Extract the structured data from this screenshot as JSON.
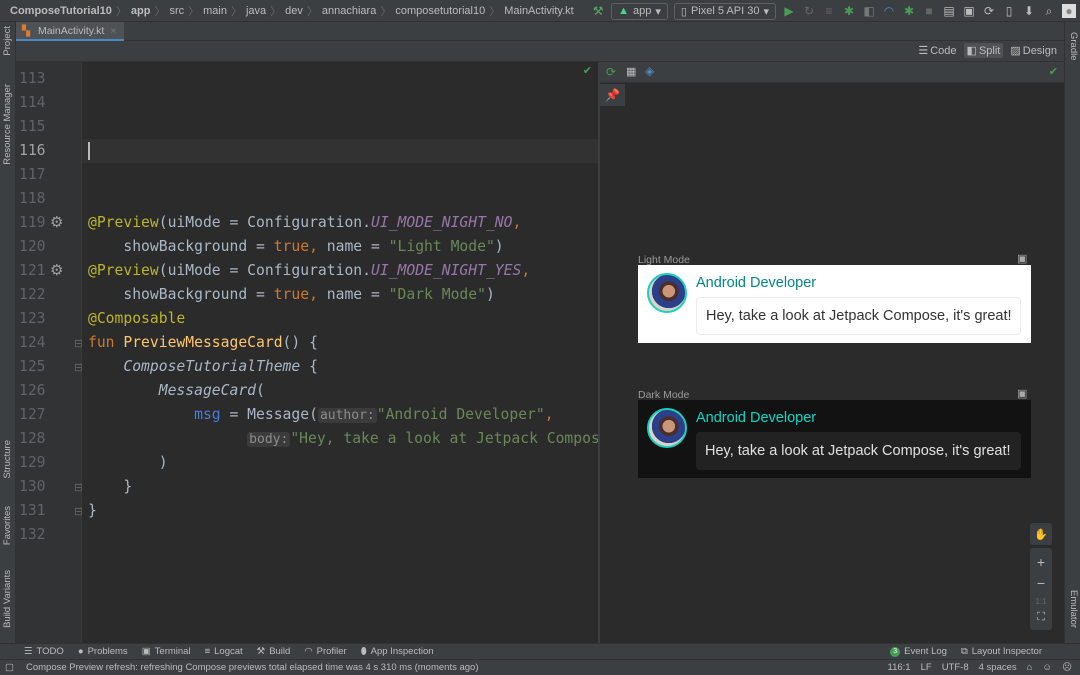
{
  "breadcrumb": [
    "ComposeTutorial10",
    "app",
    "src",
    "main",
    "java",
    "dev",
    "annachiara",
    "composetutorial10",
    "MainActivity.kt"
  ],
  "toolbar": {
    "run_config": "app",
    "device": "Pixel 5 API 30"
  },
  "tabs": [
    {
      "label": "MainActivity.kt"
    }
  ],
  "view_modes": {
    "code": "Code",
    "split": "Split",
    "design": "Design",
    "selected": "Split"
  },
  "side_left": {
    "project": "Project",
    "resource_manager": "Resource Manager",
    "structure": "Structure",
    "favorites": "Favorites",
    "build_variants": "Build Variants"
  },
  "side_right": {
    "gradle": "Gradle",
    "emulator": "Emulator"
  },
  "editor": {
    "line_numbers": [
      "113",
      "114",
      "115",
      "116",
      "117",
      "118",
      "119",
      "120",
      "121",
      "122",
      "123",
      "124",
      "125",
      "126",
      "127",
      "128",
      "129",
      "130",
      "131",
      "132"
    ],
    "current_line": "116",
    "lines": [
      [],
      [],
      [],
      [],
      [],
      [],
      [
        [
          "ann",
          "@Preview"
        ],
        [
          "",
          "(uiMode = Configuration."
        ],
        [
          "cst",
          "UI_MODE_NIGHT_NO"
        ],
        [
          "kw",
          ","
        ]
      ],
      [
        [
          "",
          "    showBackground = "
        ],
        [
          "kw",
          "true,"
        ],
        [
          "",
          " name = "
        ],
        [
          "str",
          "\"Light Mode\""
        ],
        [
          "",
          ")"
        ]
      ],
      [
        [
          "ann",
          "@Preview"
        ],
        [
          "",
          "(uiMode = Configuration."
        ],
        [
          "cst",
          "UI_MODE_NIGHT_YES"
        ],
        [
          "kw",
          ","
        ]
      ],
      [
        [
          "",
          "    showBackground = "
        ],
        [
          "kw",
          "true,"
        ],
        [
          "",
          " name = "
        ],
        [
          "str",
          "\"Dark Mode\""
        ],
        [
          "",
          ")"
        ]
      ],
      [
        [
          "ann",
          "@Composable"
        ]
      ],
      [
        [
          "kw",
          "fun "
        ],
        [
          "fn",
          "PreviewMessageCard"
        ],
        [
          "",
          "() {"
        ]
      ],
      [
        [
          "",
          "    "
        ],
        [
          "it",
          "ComposeTutorialTheme"
        ],
        [
          "",
          " {"
        ]
      ],
      [
        [
          "",
          "        "
        ],
        [
          "it",
          "MessageCard"
        ],
        [
          "",
          "("
        ]
      ],
      [
        [
          "",
          "            "
        ],
        [
          "nm",
          "msg"
        ],
        [
          "",
          " = Message("
        ],
        [
          "hint",
          "author:"
        ],
        [
          "str",
          "\"Android Developer\""
        ],
        [
          "kw",
          ","
        ]
      ],
      [
        [
          "",
          "                  "
        ],
        [
          "hint",
          "body:"
        ],
        [
          "str",
          "\"Hey, take a look at Jetpack Compose, it's great!\""
        ]
      ],
      [
        [
          "",
          "        )"
        ]
      ],
      [
        [
          "",
          "    }"
        ]
      ],
      [
        [
          "",
          "}"
        ]
      ],
      []
    ]
  },
  "preview": {
    "cards": [
      {
        "label": "Light Mode",
        "author": "Android Developer",
        "message": "Hey, take a look at Jetpack Compose, it's great!",
        "theme": "light"
      },
      {
        "label": "Dark Mode",
        "author": "Android Developer",
        "message": "Hey, take a look at Jetpack Compose, it's great!",
        "theme": "dark"
      }
    ],
    "zoom_reset": "1:1"
  },
  "tool_windows": [
    "TODO",
    "Problems",
    "Terminal",
    "Logcat",
    "Build",
    "Profiler",
    "App Inspection"
  ],
  "tool_windows_right": {
    "event_log": "Event Log",
    "event_count": "3",
    "layout_inspector": "Layout Inspector"
  },
  "status": {
    "message": "Compose Preview refresh: refreshing Compose previews total elapsed time was 4 s 310 ms (moments ago)",
    "position": "116:1",
    "line_sep": "LF",
    "encoding": "UTF-8",
    "indent": "4 spaces"
  },
  "colors": {
    "accent_teal": "#1ccfb8",
    "author_light": "#018786",
    "author_dark": "#03dac5"
  }
}
